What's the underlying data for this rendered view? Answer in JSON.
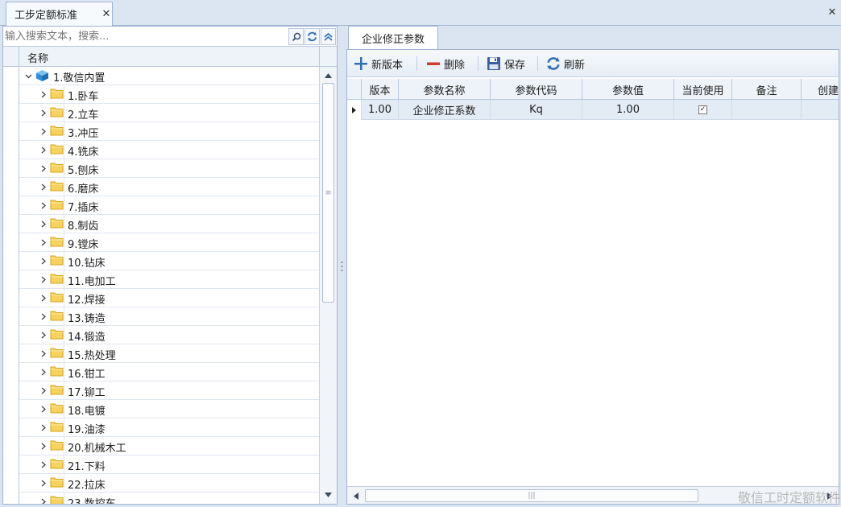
{
  "doc_tab": {
    "title": "工步定额标准",
    "close": "✕"
  },
  "global_close": "✕",
  "left": {
    "search_placeholder": "输入搜索文本，搜索...",
    "column_header": "名称",
    "root_label": "1.敬信内置",
    "items": [
      "1.卧车",
      "2.立车",
      "3.冲压",
      "4.铣床",
      "5.刨床",
      "6.磨床",
      "7.插床",
      "8.制齿",
      "9.镗床",
      "10.钻床",
      "11.电加工",
      "12.焊接",
      "13.铸造",
      "14.锻造",
      "15.热处理",
      "16.钳工",
      "17.铆工",
      "18.电镀",
      "19.油漆",
      "20.机械木工",
      "21.下料",
      "22.拉床",
      "23.数控车"
    ]
  },
  "right": {
    "tab": "企业修正参数",
    "toolbar": {
      "new_version": "新版本",
      "delete": "删除",
      "save": "保存",
      "refresh": "刷新"
    },
    "columns": [
      "版本",
      "参数名称",
      "参数代码",
      "参数值",
      "当前使用",
      "备注",
      "创建"
    ],
    "rows": [
      {
        "version": "1.00",
        "name": "企业修正系数",
        "code": "Kq",
        "value": "1.00",
        "in_use": "✓",
        "note": "",
        "created": ""
      }
    ]
  },
  "watermark": "敬信工时定额软件"
}
